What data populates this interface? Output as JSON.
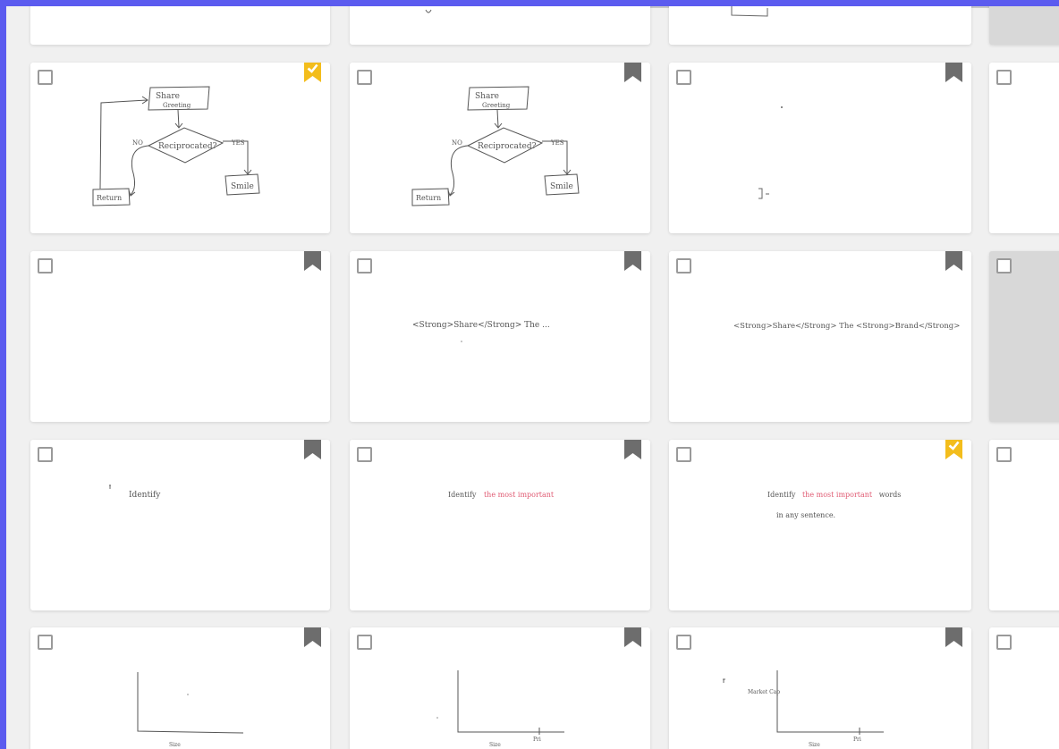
{
  "colors": {
    "frame": "#5b5bef",
    "board": "#f0f0f0",
    "card": "#ffffff",
    "bookmark": "#6d6d6d",
    "checked_bookmark": "#f3bd1c",
    "ink": "#444444",
    "red_ink": "#e05a72"
  },
  "icons": {
    "checkbox": "checkbox-icon",
    "bookmark": "bookmark-icon",
    "checked_bookmark": "bookmark-checked-icon"
  },
  "cards": {
    "r1c1": {
      "state": "bookmarked-checked",
      "sketch": "flowchart",
      "text": {
        "a": "Share",
        "b": "Greeting",
        "c": "Reciprocated?",
        "d": "NO",
        "e": "YES",
        "f": "Return",
        "g": "Smile"
      }
    },
    "r1c2": {
      "state": "bookmarked",
      "sketch": "flowchart",
      "text": {
        "a": "Share",
        "b": "Greeting",
        "c": "Reciprocated?",
        "d": "NO",
        "e": "YES",
        "f": "Return",
        "g": "Smile"
      }
    },
    "r1c3": {
      "state": "bookmarked",
      "sketch": "dots"
    },
    "r2c1": {
      "state": "bookmarked",
      "sketch": "blank"
    },
    "r2c2": {
      "state": "bookmarked",
      "text": "<Strong>Share</Strong> The ..."
    },
    "r2c3": {
      "state": "bookmarked",
      "text": "<Strong>Share</Strong> The <Strong>Brand</Strong>"
    },
    "r3c1": {
      "state": "bookmarked",
      "text": "Identify"
    },
    "r3c2": {
      "state": "bookmarked",
      "text": "Identify",
      "red": "the most important"
    },
    "r3c3": {
      "state": "bookmarked-checked",
      "text": "Identify",
      "red": "the most important",
      "tail": "words",
      "line2": "in any sentence."
    },
    "r4c1": {
      "state": "bookmarked",
      "sketch": "axes",
      "axis_label": "Size"
    },
    "r4c2": {
      "state": "bookmarked",
      "sketch": "axes",
      "axis_label": "Size",
      "axis_label2": "Pri"
    },
    "r4c3": {
      "state": "bookmarked",
      "sketch": "axes",
      "axis_label": "Size",
      "axis_label2": "Pri",
      "y_label": "Market Cap"
    }
  }
}
